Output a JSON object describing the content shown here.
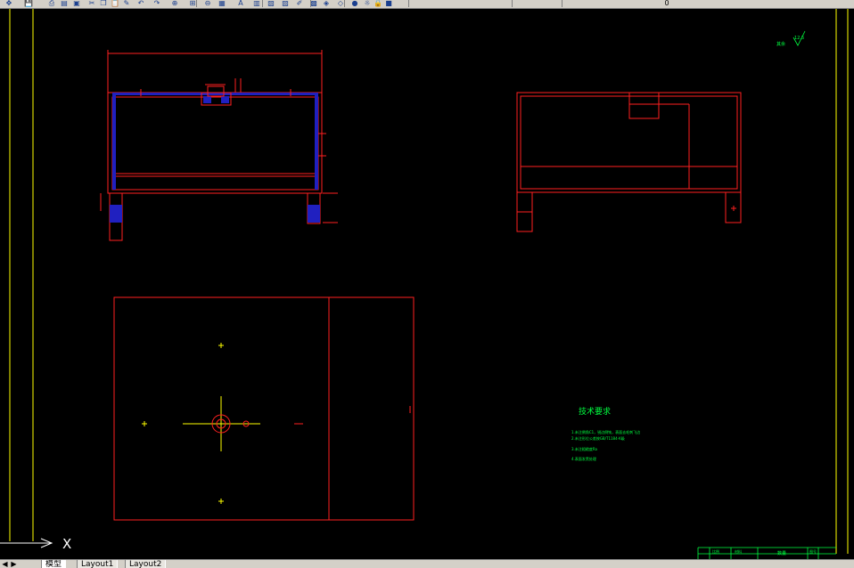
{
  "toolbar": {
    "icons": [
      "pan-icon",
      "save-icon",
      "print-icon",
      "preview-icon",
      "publish-icon",
      "cut-icon",
      "copy-icon",
      "paste-icon",
      "match-icon",
      "undo-icon",
      "redo-icon",
      "zoom-realtime-icon",
      "zoom-window-icon",
      "zoom-previous-icon",
      "properties-icon",
      "text-icon",
      "design-center-icon",
      "tool-palette-icon",
      "sheet-set-icon",
      "markup-icon",
      "calc-icon",
      "layer-icon",
      "layer-state-icon",
      "bulb-icon",
      "sun-icon",
      "lock-icon",
      "color-swatch-icon"
    ],
    "trailing_text": "0"
  },
  "drawing": {
    "colors": {
      "outline": "#ff2020",
      "center": "#ffff00",
      "note": "#00ff40",
      "hatch": "#2020c0",
      "border": "#ffff00"
    },
    "roughness_symbol": "12.5",
    "notes_title": "技术要求",
    "notes_lines": [
      "1.未注倒角C1，锐边倒钝，表面去毛刺飞边",
      "2.未注形位公差按GB/T1184-K级",
      "3.未注粗糙度Ra",
      "4.表面发黑处理"
    ],
    "title_block": {
      "cells": [
        "比例",
        "材料",
        "数量",
        "图号",
        "",
        "",
        ""
      ]
    }
  },
  "tabs": {
    "nav": [
      "◀",
      "▶"
    ],
    "items": [
      {
        "label": "模型",
        "active": true
      },
      {
        "label": "Layout1",
        "active": false
      },
      {
        "label": "Layout2",
        "active": false
      }
    ]
  },
  "ucs": {
    "axis_label": "X"
  }
}
